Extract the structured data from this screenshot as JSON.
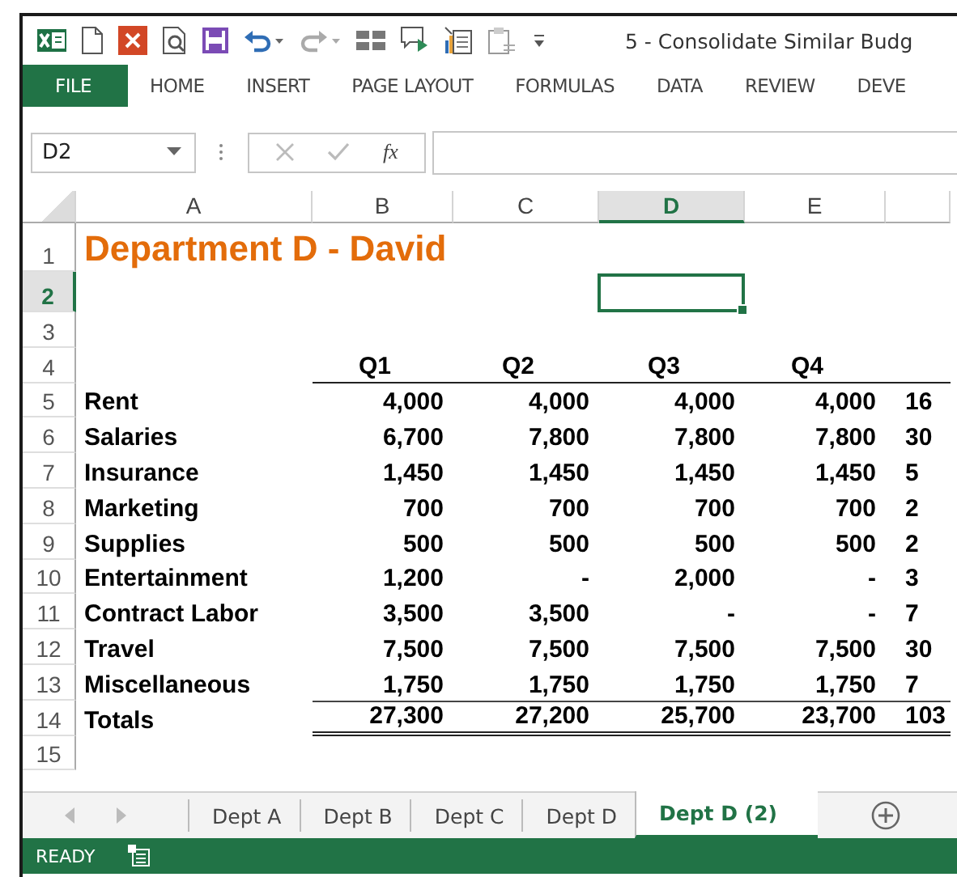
{
  "window": {
    "title": "5 - Consolidate Similar Budg"
  },
  "ribbon_tabs": [
    {
      "label": "FILE",
      "kind": "file",
      "selected": false
    },
    {
      "label": "HOME",
      "kind": "tab",
      "selected": false
    },
    {
      "label": "INSERT",
      "kind": "tab",
      "selected": false
    },
    {
      "label": "PAGE LAYOUT",
      "kind": "tab",
      "selected": false
    },
    {
      "label": "FORMULAS",
      "kind": "tab",
      "selected": false
    },
    {
      "label": "DATA",
      "kind": "tab",
      "selected": false
    },
    {
      "label": "REVIEW",
      "kind": "tab",
      "selected": false
    },
    {
      "label": "DEVE",
      "kind": "tab",
      "selected": false
    }
  ],
  "name_box": {
    "value": "D2"
  },
  "formula_bar": {
    "function_symbol": "fx"
  },
  "columns": [
    {
      "label": "A",
      "selected": false
    },
    {
      "label": "B",
      "selected": false
    },
    {
      "label": "C",
      "selected": false
    },
    {
      "label": "D",
      "selected": true
    },
    {
      "label": "E",
      "selected": false
    }
  ],
  "rows": [
    {
      "number": "1",
      "selected": false,
      "kind": "title",
      "label": "Department D - David"
    },
    {
      "number": "2",
      "selected": true,
      "kind": "blank"
    },
    {
      "number": "3",
      "selected": false,
      "kind": "blank"
    },
    {
      "number": "4",
      "selected": false,
      "kind": "header",
      "values": [
        "Q1",
        "Q2",
        "Q3",
        "Q4"
      ]
    },
    {
      "number": "5",
      "selected": false,
      "kind": "data",
      "label": "Rent",
      "values": [
        "4,000",
        "4,000",
        "4,000",
        "4,000",
        "16"
      ]
    },
    {
      "number": "6",
      "selected": false,
      "kind": "data",
      "label": "Salaries",
      "values": [
        "6,700",
        "7,800",
        "7,800",
        "7,800",
        "30"
      ]
    },
    {
      "number": "7",
      "selected": false,
      "kind": "data",
      "label": "Insurance",
      "values": [
        "1,450",
        "1,450",
        "1,450",
        "1,450",
        "5"
      ]
    },
    {
      "number": "8",
      "selected": false,
      "kind": "data",
      "label": "Marketing",
      "values": [
        "700",
        "700",
        "700",
        "700",
        "2"
      ]
    },
    {
      "number": "9",
      "selected": false,
      "kind": "data",
      "label": "Supplies",
      "values": [
        "500",
        "500",
        "500",
        "500",
        "2"
      ]
    },
    {
      "number": "10",
      "selected": false,
      "kind": "data",
      "label": "Entertainment",
      "values": [
        "1,200",
        "-",
        "2,000",
        "-",
        "3"
      ]
    },
    {
      "number": "11",
      "selected": false,
      "kind": "data",
      "label": "Contract Labor",
      "values": [
        "3,500",
        "3,500",
        "-",
        "-",
        "7"
      ]
    },
    {
      "number": "12",
      "selected": false,
      "kind": "data",
      "label": "Travel",
      "values": [
        "7,500",
        "7,500",
        "7,500",
        "7,500",
        "30"
      ]
    },
    {
      "number": "13",
      "selected": false,
      "kind": "data",
      "label": "Miscellaneous",
      "values": [
        "1,750",
        "1,750",
        "1,750",
        "1,750",
        "7"
      ]
    },
    {
      "number": "14",
      "selected": false,
      "kind": "total",
      "label": "Totals",
      "values": [
        "27,300",
        "27,200",
        "25,700",
        "23,700",
        "103"
      ]
    },
    {
      "number": "15",
      "selected": false,
      "kind": "blank"
    }
  ],
  "sheet_tabs": [
    {
      "label": "Dept A",
      "selected": false
    },
    {
      "label": "Dept B",
      "selected": false
    },
    {
      "label": "Dept C",
      "selected": false
    },
    {
      "label": "Dept D",
      "selected": false
    },
    {
      "label": "Dept D (2)",
      "selected": true
    }
  ],
  "status_bar": {
    "mode": "READY"
  }
}
